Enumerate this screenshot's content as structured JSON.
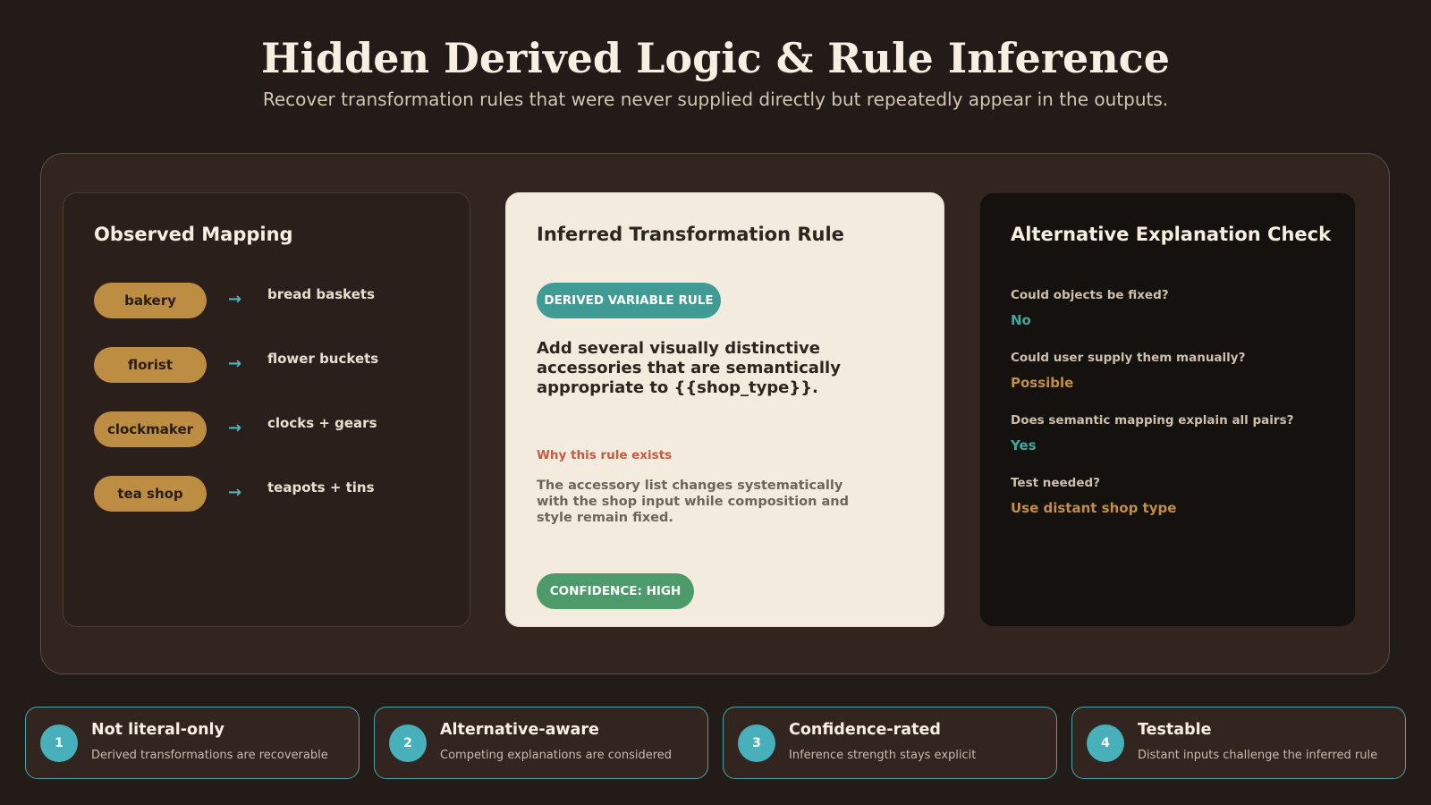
{
  "header": {
    "title": "Hidden Derived Logic & Rule Inference",
    "subtitle": "Recover transformation rules that were never supplied directly but repeatedly appear in the outputs."
  },
  "observed": {
    "title": "Observed Mapping",
    "arrow": "→",
    "rows": [
      {
        "shop": "bakery",
        "output": "bread baskets"
      },
      {
        "shop": "florist",
        "output": "flower buckets"
      },
      {
        "shop": "clockmaker",
        "output": "clocks + gears"
      },
      {
        "shop": "tea shop",
        "output": "teapots + tins"
      }
    ]
  },
  "inferred": {
    "title": "Inferred Transformation Rule",
    "badge": "DERIVED VARIABLE RULE",
    "rule": "Add several visually distinctive accessories that are semantically appropriate to {{shop_type}}.",
    "why_label": "Why this rule exists",
    "why_body": "The accessory list changes systematically with the shop input while composition and style remain fixed.",
    "confidence": "CONFIDENCE: HIGH"
  },
  "alternative": {
    "title": "Alternative Explanation Check",
    "checks": [
      {
        "question": "Could objects be fixed?",
        "answer": "No",
        "color": "#3fa6a3"
      },
      {
        "question": "Could user supply them manually?",
        "answer": "Possible",
        "color": "#c18e45"
      },
      {
        "question": "Does semantic mapping explain all pairs?",
        "answer": "Yes",
        "color": "#3fa6a3"
      },
      {
        "question": "Test needed?",
        "answer": "Use distant shop type",
        "color": "#c18e45"
      }
    ]
  },
  "cards": [
    {
      "num": "1",
      "title": "Not literal-only",
      "desc": "Derived transformations are recoverable"
    },
    {
      "num": "2",
      "title": "Alternative-aware",
      "desc": "Competing explanations are considered"
    },
    {
      "num": "3",
      "title": "Confidence-rated",
      "desc": "Inference strength stays explicit"
    },
    {
      "num": "4",
      "title": "Testable",
      "desc": "Distant inputs challenge the inferred rule"
    }
  ]
}
